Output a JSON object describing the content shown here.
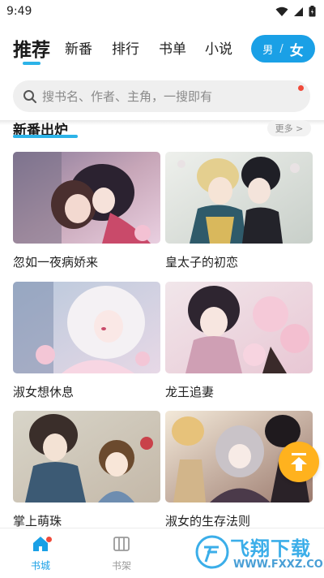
{
  "status": {
    "time": "9:49"
  },
  "tabs": [
    {
      "label": "推荐",
      "active": true
    },
    {
      "label": "新番"
    },
    {
      "label": "排行"
    },
    {
      "label": "书单"
    },
    {
      "label": "小说"
    }
  ],
  "gender": {
    "male": "男",
    "separator": "/",
    "female": "女"
  },
  "search": {
    "placeholder": "搜书名、作者、主角，一搜即有"
  },
  "section": {
    "title": "新番出炉",
    "more": "更多 >"
  },
  "books": [
    {
      "title": "忽如一夜病娇来"
    },
    {
      "title": "皇太子的初恋"
    },
    {
      "title": "淑女想休息"
    },
    {
      "title": "龙王追妻"
    },
    {
      "title": "掌上萌珠"
    },
    {
      "title": "淑女的生存法则"
    }
  ],
  "nav": [
    {
      "label": "书城",
      "active": true
    },
    {
      "label": "书架"
    }
  ],
  "watermark": {
    "text": "飞翔下载",
    "url": "WWW.FXXZ.COM"
  },
  "colors": {
    "accent": "#1aa0e6",
    "underline": "#2cb3e8",
    "fab": "#ffb21e",
    "badge": "#f04a3a"
  }
}
